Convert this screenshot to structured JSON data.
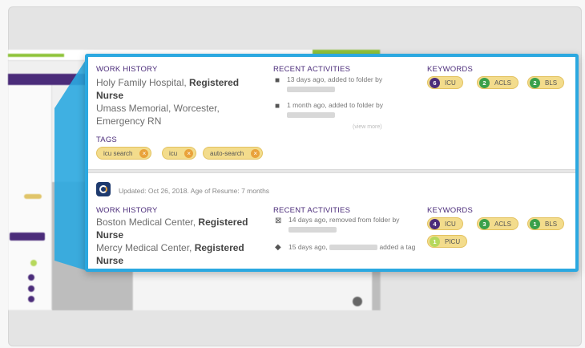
{
  "colors": {
    "accent": "#2ba8e0",
    "heading": "#4b2c7a",
    "pill": "#f3dc8c",
    "green": "#3aa04a",
    "purple": "#4b2c7a"
  },
  "candidate1": {
    "work_history_label": "WORK HISTORY",
    "jobs": [
      {
        "place": "Holy Family Hospital,",
        "role": "Registered Nurse"
      },
      {
        "place": "Umass Memorial, Worcester,",
        "role": "Emergency RN"
      }
    ],
    "recent_label": "RECENT ACTIVITIES",
    "activities": [
      {
        "icon": "folder-icon",
        "text": "13 days ago, added to folder by"
      },
      {
        "icon": "folder-icon",
        "text": "1 month ago, added to folder by"
      }
    ],
    "view_more": "(view more)",
    "keywords_label": "KEYWORDS",
    "keywords": [
      {
        "count": "6",
        "label": "ICU",
        "color": "#4b2c7a"
      },
      {
        "count": "2",
        "label": "ACLS",
        "color": "#3aa04a"
      },
      {
        "count": "2",
        "label": "BLS",
        "color": "#3aa04a"
      }
    ],
    "tags_label": "TAGS",
    "tags": [
      "icu search",
      "icu",
      "auto-search"
    ]
  },
  "candidate2": {
    "updated": "Updated: Oct 26, 2018. Age of Resume: 7 months",
    "work_history_label": "WORK HISTORY",
    "jobs": [
      {
        "place": "Boston Medical Center,",
        "role": "Registered Nurse"
      },
      {
        "place": "Mercy Medical Center,",
        "role": "Registered Nurse"
      }
    ],
    "recent_label": "RECENT ACTIVITIES",
    "activities": [
      {
        "icon": "folder-remove-icon",
        "text": "14 days ago, removed from folder by"
      },
      {
        "icon": "tag-icon",
        "text": "15 days ago,",
        "suffix": "added a tag"
      }
    ],
    "keywords_label": "KEYWORDS",
    "keywords": [
      {
        "count": "4",
        "label": "ICU",
        "color": "#4b2c7a"
      },
      {
        "count": "3",
        "label": "ACLS",
        "color": "#3aa04a"
      },
      {
        "count": "1",
        "label": "BLS",
        "color": "#3aa04a"
      },
      {
        "count": "1",
        "label": "PICU",
        "color": "#b6d85c"
      }
    ]
  }
}
